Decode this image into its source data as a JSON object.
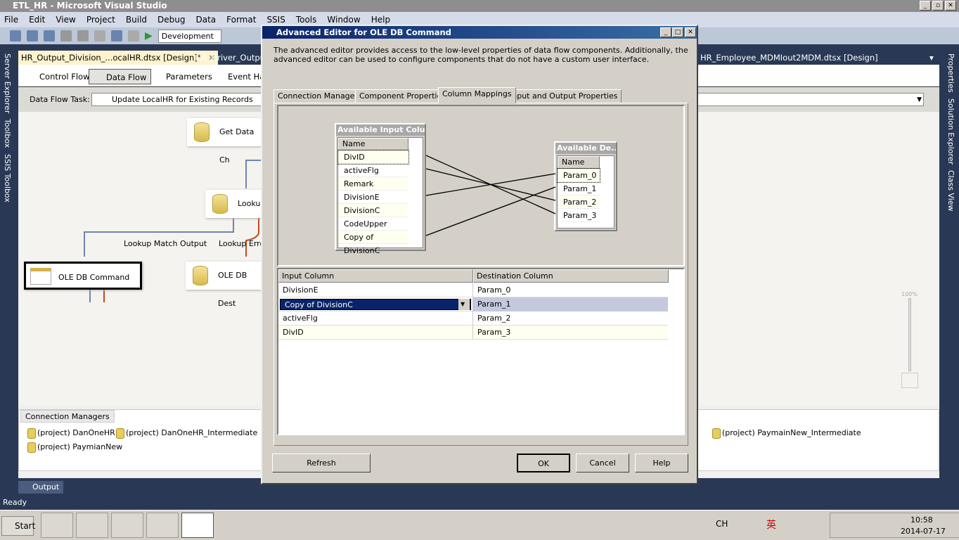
{
  "window": {
    "title": "ETL_HR - Microsoft Visual Studio"
  },
  "menu": [
    "File",
    "Edit",
    "View",
    "Project",
    "Build",
    "Debug",
    "Data",
    "Format",
    "SSIS",
    "Tools",
    "Window",
    "Help"
  ],
  "toolbar": {
    "configuration": "Development"
  },
  "left_panels": [
    "Server Explorer",
    "Toolbox",
    "SSIS Toolbox"
  ],
  "right_panels": [
    "Properties",
    "Solution Explorer",
    "Class View"
  ],
  "doc_tabs": [
    "HR_Output_Division_...ocalHR.dtsx [Design]*",
    "HR_Driver_OutputI",
    "HR_Employee_MDMIout2MDM.dtsx [Design]"
  ],
  "designer_tabs": [
    "Control Flow",
    "Data Flow",
    "Parameters",
    "Event Han"
  ],
  "data_flow_task": {
    "label": "Data Flow Task:",
    "value": "Update LocalHR for Existing Records"
  },
  "canvas": {
    "components": [
      "Get Data Ch",
      "Lookup",
      "OLE DB Command",
      "OLE DB Dest"
    ],
    "paths": [
      "Lookup Match Output",
      "Lookup Error"
    ],
    "zoom": "100%"
  },
  "connection_managers": {
    "title": "Connection Managers",
    "items": [
      "(project) DanOneHR",
      "(project) DanOneHR_Intermediate",
      "(project) PaymainNew_Intermediate",
      "(project) PaymianNew"
    ]
  },
  "output_tab": "Output",
  "status": "Ready",
  "dialog": {
    "title": "Advanced Editor for OLE DB Command",
    "description": "The advanced editor provides access to the low-level properties of data flow components. Additionally, the advanced editor can be used to configure components that do not have a custom user interface.",
    "tabs": [
      "Connection Managers",
      "Component Properties",
      "Column Mappings",
      "Input and Output Properties"
    ],
    "active_tab": "Column Mappings",
    "input_box": {
      "title": "Available Input Colu...",
      "header": "Name",
      "columns": [
        "DivID",
        "activeFlg",
        "Remark",
        "DivisionE",
        "DivisionC",
        "CodeUpper",
        "Copy of DivisionC"
      ]
    },
    "dest_box": {
      "title": "Available De...",
      "header": "Name",
      "columns": [
        "Param_0",
        "Param_1",
        "Param_2",
        "Param_3"
      ]
    },
    "grid": {
      "headers": [
        "Input Column",
        "Destination Column"
      ],
      "rows": [
        [
          "DivisionE",
          "Param_0"
        ],
        [
          "Copy of DivisionC",
          "Param_1"
        ],
        [
          "activeFlg",
          "Param_2"
        ],
        [
          "DivID",
          "Param_3"
        ]
      ],
      "selected_row": 1
    },
    "buttons": {
      "refresh": "Refresh",
      "ok": "OK",
      "cancel": "Cancel",
      "help": "Help"
    }
  },
  "taskbar": {
    "start": "Start",
    "lang": "CH",
    "ime": "英",
    "time": "10:58",
    "date": "2014-07-17"
  }
}
